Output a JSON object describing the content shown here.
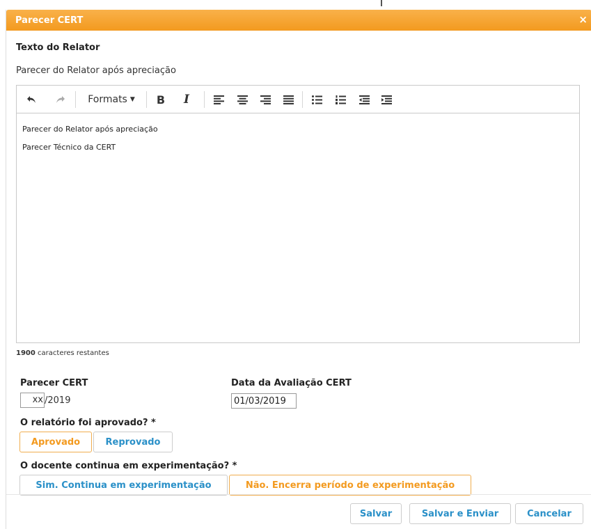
{
  "dialog": {
    "title": "Parecer CERT",
    "close_glyph": "×"
  },
  "relator": {
    "section_title": "Texto do Relator",
    "subtitle": "Parecer do Relator após apreciação"
  },
  "editor": {
    "toolbar": {
      "formats_label": "Formats",
      "bold_label": "B",
      "italic_label": "I"
    },
    "content": [
      "Parecer do Relator após apreciação",
      "Parecer Técnico da CERT"
    ],
    "chars_remaining_count": "1900",
    "chars_remaining_text": "caracteres restantes"
  },
  "form": {
    "parecer_label": "Parecer CERT",
    "parecer_prefix_value": "xx",
    "parecer_suffix": "/2019",
    "date_label": "Data da Avaliação CERT",
    "date_value": "01/03/2019",
    "approved_question": "O relatório foi aprovado? *",
    "approved_options": [
      "Aprovado",
      "Reprovado"
    ],
    "approved_selected": "Aprovado",
    "continues_question": "O docente continua em experimentação? *",
    "continues_options": [
      "Sim. Continua em experimentação",
      "Não. Encerra período de experimentação"
    ],
    "continues_selected": "Não. Encerra período de experimentação"
  },
  "footer": {
    "save_label": "Salvar",
    "save_send_label": "Salvar e Enviar",
    "cancel_label": "Cancelar"
  },
  "colors": {
    "header_orange": "#f39a1f",
    "selected_text": "#f39a1f",
    "link_blue": "#2a90c8"
  },
  "icons": [
    "undo-icon",
    "redo-icon",
    "align-left-icon",
    "align-center-icon",
    "align-right-icon",
    "align-justify-icon",
    "bullet-list-icon",
    "numbered-list-icon",
    "outdent-icon",
    "indent-icon",
    "close-icon"
  ]
}
